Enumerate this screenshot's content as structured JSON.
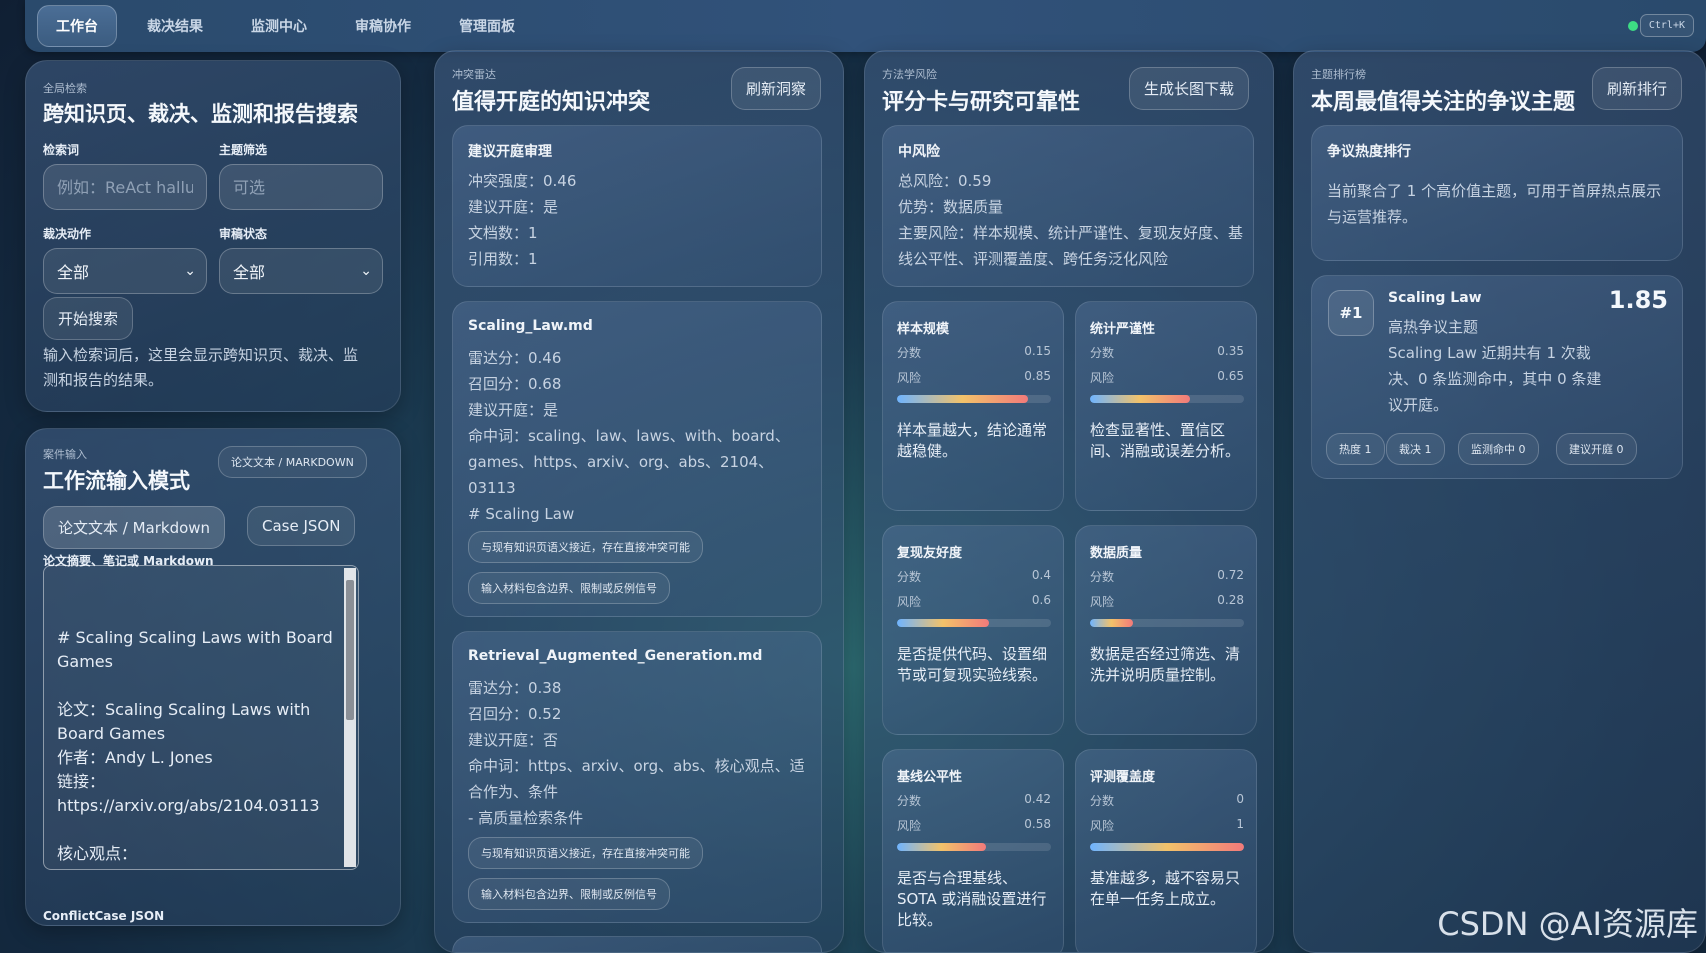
{
  "nav": {
    "tabs": [
      {
        "label": "工作台",
        "active": true
      },
      {
        "label": "裁决结果"
      },
      {
        "label": "监测中心"
      },
      {
        "label": "审稿协作"
      },
      {
        "label": "管理面板"
      }
    ],
    "shortcut": "Ctrl+K",
    "status_color": "#3ddc84"
  },
  "search": {
    "eyebrow": "全局检索",
    "title": "跨知识页、裁决、监测和报告搜索",
    "query_label": "检索词",
    "query_placeholder": "例如：ReAct hallu",
    "topic_label": "主题筛选",
    "topic_placeholder": "可选",
    "action_label": "裁决动作",
    "action_value": "全部",
    "review_label": "审稿状态",
    "review_value": "全部",
    "button": "开始搜索",
    "hint": "输入检索词后，这里会显示跨知识页、裁决、监测和报告的结果。"
  },
  "workflow": {
    "eyebrow": "案件输入",
    "title": "工作流输入模式",
    "mode_badge": "论文文本 / MARKDOWN",
    "mode_markdown": "论文文本 / Markdown",
    "mode_json": "Case JSON",
    "editor_label": "论文摘要、笔记或 Markdown",
    "editor_text": "# Scaling Scaling Laws with Board Games\n\n论文：Scaling Scaling Laws with Board Games\n作者：Andy L. Jones\n链接：\nhttps://arxiv.org/abs/2104.03113\n\n核心观点：\n- 在棋类环境中，模型规模、数据和算力与性能提升之间存在可观察的 scaling 关系",
    "footer_label": "ConflictCase JSON"
  },
  "conflicts": {
    "eyebrow": "冲突雷达",
    "title": "值得开庭的知识冲突",
    "refresh": "刷新洞察",
    "summary": {
      "title": "建议开庭审理",
      "lines": [
        "冲突强度：0.46",
        "建议开庭：是",
        "文档数：1",
        "引用数：1"
      ]
    },
    "items": [
      {
        "title": "Scaling_Law.md",
        "lines": [
          "雷达分：0.46",
          "召回分：0.68",
          "建议开庭：是",
          "命中词：scaling、law、laws、with、board、games、https、arxiv、org、abs、2104、03113",
          "# Scaling Law"
        ],
        "tags": [
          "与现有知识页语义接近，存在直接冲突可能",
          "输入材料包含边界、限制或反例信号"
        ]
      },
      {
        "title": "Retrieval_Augmented_Generation.md",
        "lines": [
          "雷达分：0.38",
          "召回分：0.52",
          "建议开庭：否",
          "命中词：https、arxiv、org、abs、核心观点、适合作为、条件",
          "- 高质量检索条件"
        ],
        "tags": [
          "与现有知识页语义接近，存在直接冲突可能",
          "输入材料包含边界、限制或反例信号"
        ]
      }
    ]
  },
  "methodology": {
    "eyebrow": "方法学风险",
    "title": "评分卡与研究可靠性",
    "download": "生成长图下载",
    "summary": {
      "title": "中风险",
      "lines": [
        "总风险：0.59",
        "优势：数据质量",
        "主要风险：样本规模、统计严谨性、复现友好度、基线公平性、评测覆盖度、跨任务泛化风险"
      ]
    },
    "score_label": "分数",
    "risk_label": "风险",
    "metrics": [
      {
        "name": "样本规模",
        "score": "0.15",
        "risk": "0.85",
        "risk_value": 0.85,
        "desc": "样本量越大，结论通常越稳健。"
      },
      {
        "name": "统计严谨性",
        "score": "0.35",
        "risk": "0.65",
        "risk_value": 0.65,
        "desc": "检查显著性、置信区间、消融或误差分析。"
      },
      {
        "name": "复现友好度",
        "score": "0.4",
        "risk": "0.6",
        "risk_value": 0.6,
        "desc": "是否提供代码、设置细节或可复现实验线索。"
      },
      {
        "name": "数据质量",
        "score": "0.72",
        "risk": "0.28",
        "risk_value": 0.28,
        "desc": "数据是否经过筛选、清洗并说明质量控制。"
      },
      {
        "name": "基线公平性",
        "score": "0.42",
        "risk": "0.58",
        "risk_value": 0.58,
        "desc": "是否与合理基线、SOTA 或消融设置进行比较。"
      },
      {
        "name": "评测覆盖度",
        "score": "0",
        "risk": "1",
        "risk_value": 1.0,
        "desc": "基准越多，越不容易只在单一任务上成立。"
      }
    ]
  },
  "ranking": {
    "eyebrow": "主题排行榜",
    "title": "本周最值得关注的争议主题",
    "refresh": "刷新排行",
    "intro_title": "争议热度排行",
    "intro_text": "当前聚合了 1 个高价值主题，可用于首屏热点展示与运营推荐。",
    "items": [
      {
        "rank": "#1",
        "name": "Scaling Law",
        "score": "1.85",
        "subtitle": "高热争议主题",
        "desc": "Scaling Law 近期共有 1 次裁决、0 条监测命中，其中 0 条建议开庭。",
        "chips": [
          "热度 1",
          "裁决 1",
          "监测命中 0",
          "建议开庭 0"
        ]
      }
    ]
  },
  "watermark": "CSDN @AI资源库"
}
